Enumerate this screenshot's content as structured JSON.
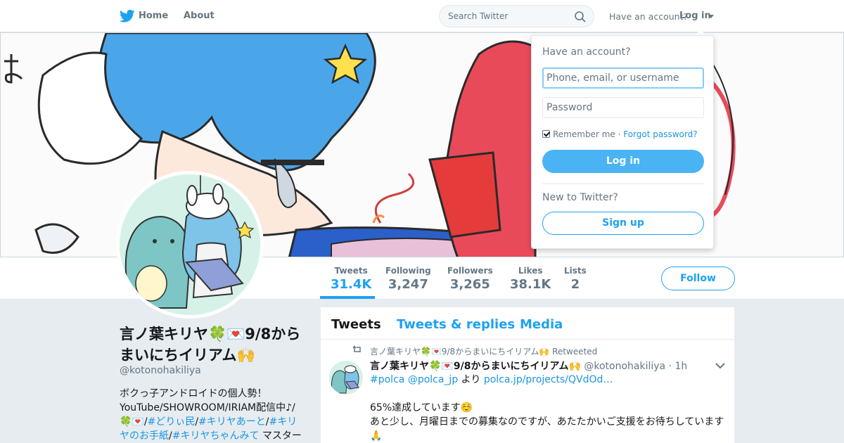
{
  "nav": {
    "home_label": "Home",
    "about_label": "About",
    "search_placeholder": "Search Twitter",
    "have_account": "Have an account?",
    "login_label": "Log in"
  },
  "profile": {
    "name": "言ノ葉キリヤ🍀💌9/8からまいにちイリアム🙌",
    "handle": "@kotonohakiliya",
    "bio_line1": "ボクっ子アンドロイドの個人勢！",
    "bio_line2": "YouTube/SHOWROOM/IRIAM配信中♪/",
    "bio_emoji": "🍀💌/",
    "bio_tag1": "#どりぃ民",
    "bio_tag2": "#キリヤあーと",
    "bio_tag3": "#キリヤのお手紙",
    "bio_tag4": "#キリヤちゃんみて",
    "bio_tail": " マスター"
  },
  "stats": [
    {
      "label": "Tweets",
      "value": "31.4K"
    },
    {
      "label": "Following",
      "value": "3,247"
    },
    {
      "label": "Followers",
      "value": "3,265"
    },
    {
      "label": "Likes",
      "value": "38.1K"
    },
    {
      "label": "Lists",
      "value": "2"
    }
  ],
  "follow_label": "Follow",
  "timeline": {
    "tabs": [
      "Tweets",
      "Tweets & replies",
      "Media"
    ],
    "retweet_line": "言ノ葉キリヤ🍀💌9/8からまいにちイリアム🙌 Retweeted",
    "tweet": {
      "fullname": "言ノ葉キリヤ🍀💌9/8からまいにちイリアム🙌",
      "handle": "@kotonohakiliya",
      "time": "· 1h",
      "tag": "#polca",
      "mention": "@polca_jp",
      "yori": "より",
      "url": "polca.jp/projects/QVdOd…",
      "line2": "65%達成しています☺️",
      "line3": "あと少し、月曜日までの募集なのですが、あたたかいご支援をお待ちしています",
      "line4": "🙏"
    }
  },
  "login_dropdown": {
    "title": "Have an account?",
    "username_placeholder": "Phone, email, or username",
    "password_placeholder": "Password",
    "remember_me": "Remember me",
    "separator": " · ",
    "forgot": "Forgot password?",
    "login_button": "Log in",
    "new_to_twitter": "New to Twitter?",
    "signup_button": "Sign up"
  },
  "colors": {
    "accent": "#1da1f2",
    "login_button_bg": "#4ab3f4",
    "page_bg": "#e6ecf0"
  }
}
